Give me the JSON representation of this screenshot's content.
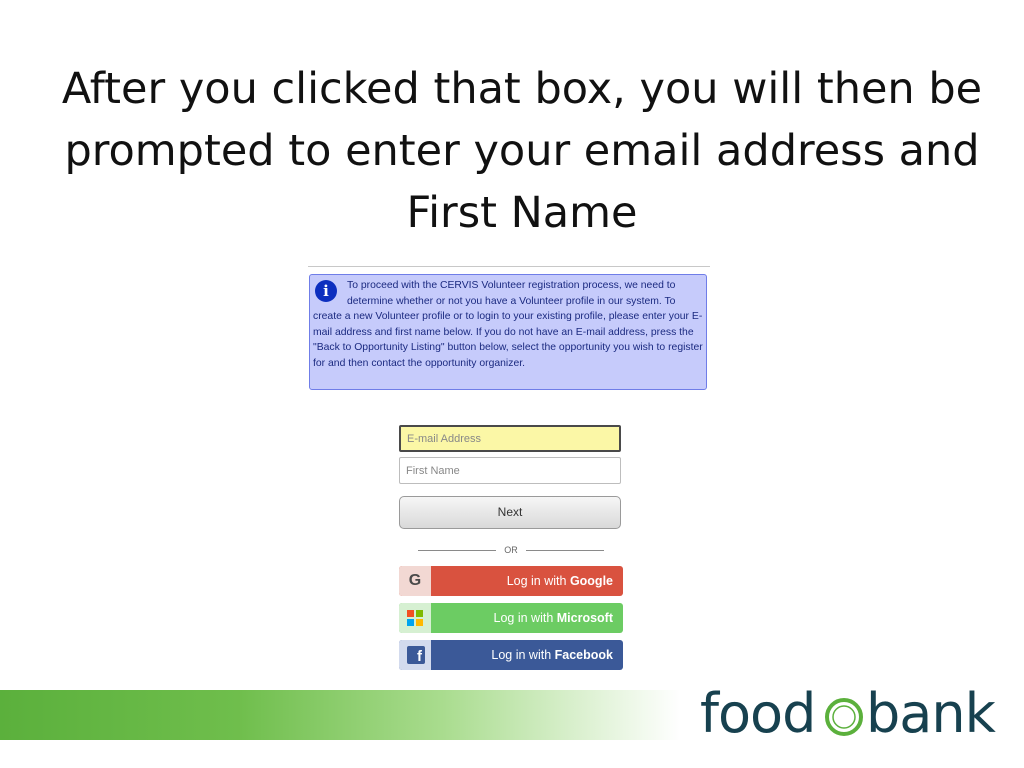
{
  "slide": {
    "title": "After you clicked that box, you will then be prompted to enter your email address and First Name"
  },
  "form": {
    "info_message": "To proceed with the CERVIS Volunteer registration process, we need to determine whether or not you have a Volunteer profile in our system. To create a new Volunteer profile or to login to your existing profile, please enter your E-mail address and first name below. If you do not have an E-mail address, press the \"Back to Opportunity Listing\" button below, select the opportunity you wish to register for and then contact the opportunity organizer.",
    "info_icon": "info-icon",
    "email_placeholder": "E-mail Address",
    "email_value": "",
    "firstname_placeholder": "First Name",
    "firstname_value": "",
    "next_label": "Next",
    "or_label": "OR",
    "google": {
      "prefix": "Log in with ",
      "brand": "Google",
      "icon": "google-icon",
      "color": "#d9523f"
    },
    "microsoft": {
      "prefix": "Log in with ",
      "brand": "Microsoft",
      "icon": "microsoft-icon",
      "color": "#6ccc63"
    },
    "facebook": {
      "prefix": "Log in with ",
      "brand": "Facebook",
      "icon": "facebook-icon",
      "color": "#3b5998"
    }
  },
  "branding": {
    "logo_left": "food",
    "logo_right": "bank",
    "logo_color": "#17414f",
    "band_color": "#5bb03c"
  }
}
